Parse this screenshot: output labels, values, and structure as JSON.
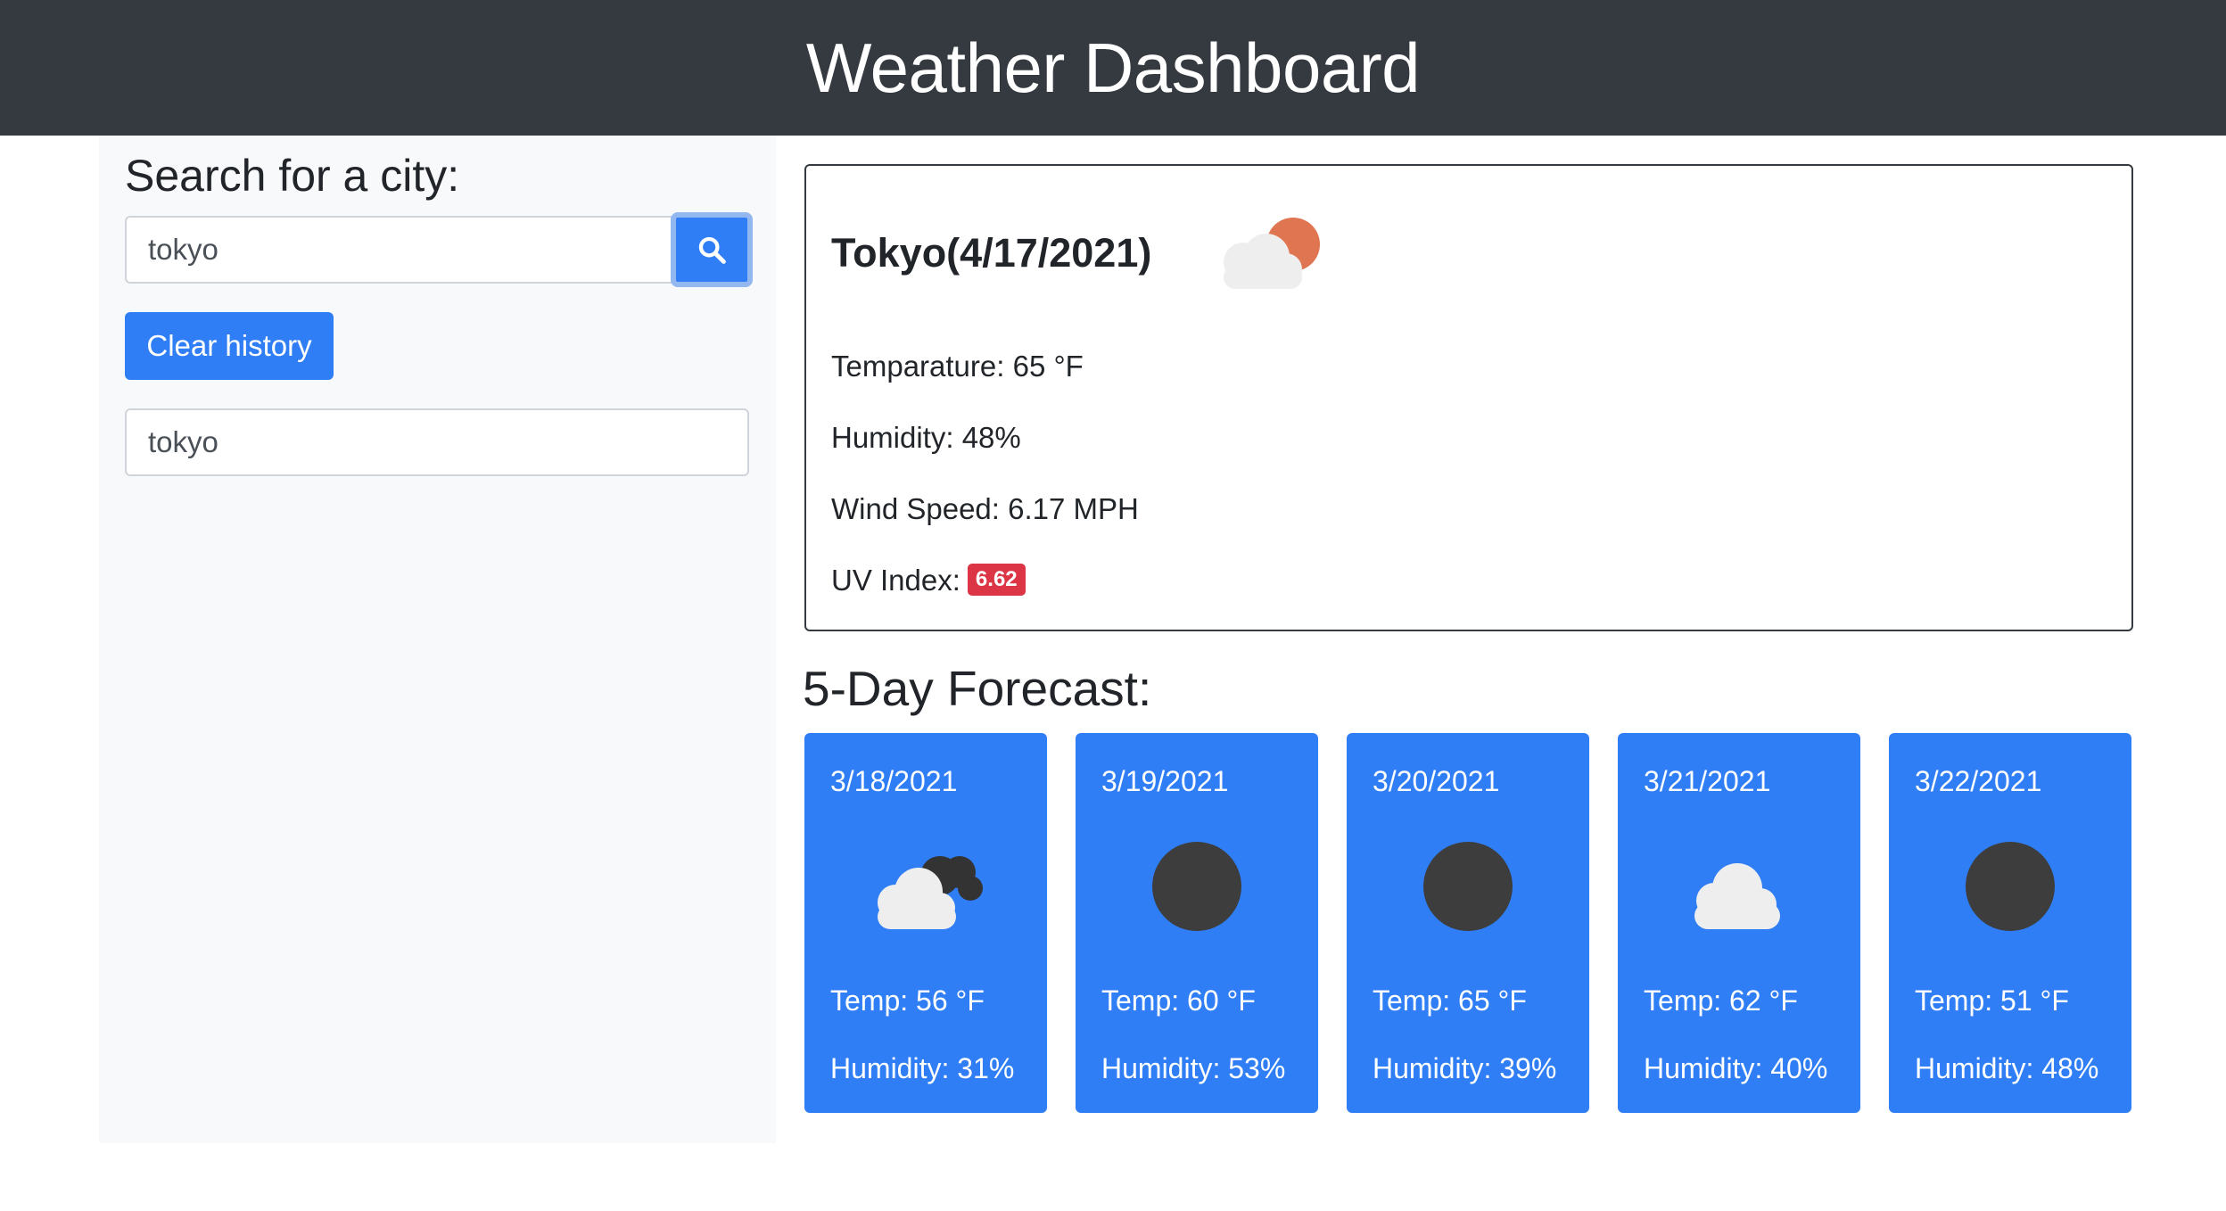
{
  "header": {
    "title": "Weather Dashboard"
  },
  "search": {
    "label": "Search for a city:",
    "value": "tokyo",
    "button_icon": "search-icon"
  },
  "clear_button": {
    "label": "Clear history"
  },
  "history": [
    {
      "city": "tokyo"
    }
  ],
  "current": {
    "title": "Tokyo(4/17/2021)",
    "icon": "cloud-sun-icon",
    "temperature": "Temparature: 65 °F",
    "humidity": "Humidity: 48%",
    "wind": "Wind Speed: 6.17 MPH",
    "uv_label": "UV Index:",
    "uv_value": "6.62"
  },
  "forecast": {
    "title": "5-Day Forecast:",
    "days": [
      {
        "date": "3/18/2021",
        "icon": "cloud-dark-cloud-icon",
        "temp": "Temp: 56 °F",
        "humidity": "Humidity: 31%"
      },
      {
        "date": "3/19/2021",
        "icon": "dark-moon-icon",
        "temp": "Temp: 60 °F",
        "humidity": "Humidity: 53%"
      },
      {
        "date": "3/20/2021",
        "icon": "dark-moon-icon",
        "temp": "Temp: 65 °F",
        "humidity": "Humidity: 39%"
      },
      {
        "date": "3/21/2021",
        "icon": "cloud-icon",
        "temp": "Temp: 62 °F",
        "humidity": "Humidity: 40%"
      },
      {
        "date": "3/22/2021",
        "icon": "dark-moon-icon",
        "temp": "Temp: 51 °F",
        "humidity": "Humidity: 48%"
      }
    ]
  },
  "colors": {
    "navbar": "#343a40",
    "primary": "#2f7ef5",
    "uv_badge": "#dc3545",
    "sidebar": "#f8f9fa"
  }
}
